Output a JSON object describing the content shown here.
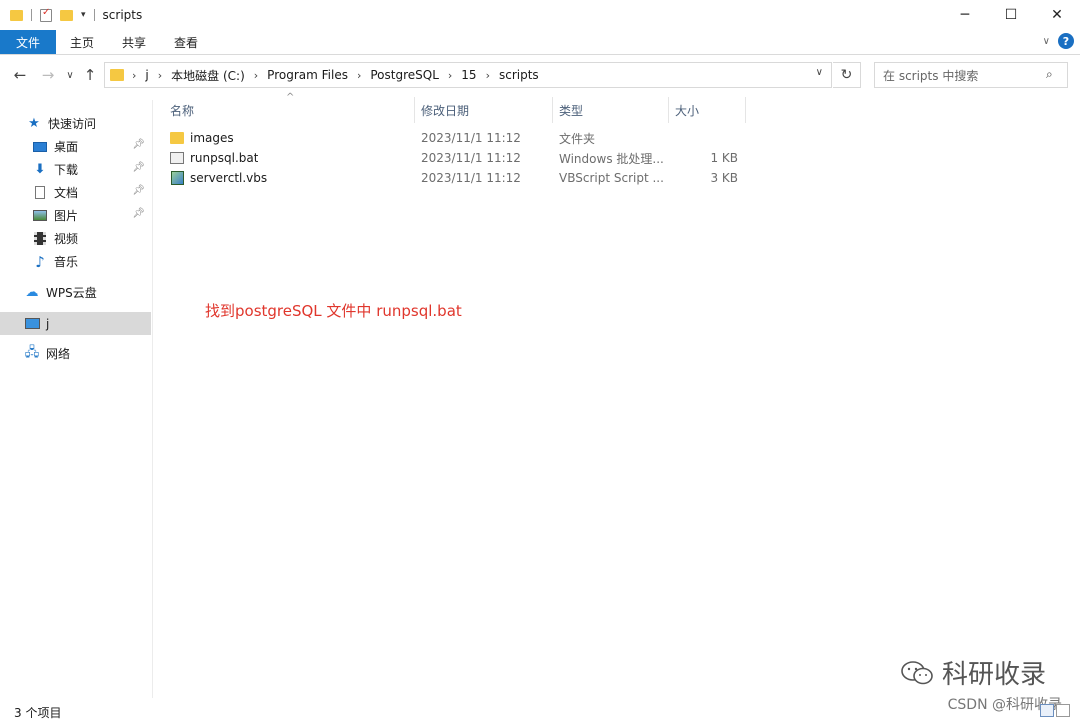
{
  "window": {
    "title": "scripts"
  },
  "ribbon": {
    "tabs": [
      "文件",
      "主页",
      "共享",
      "查看"
    ]
  },
  "address": {
    "crumbs": [
      "j",
      "本地磁盘 (C:)",
      "Program Files",
      "PostgreSQL",
      "15",
      "scripts"
    ],
    "search_placeholder": "在 scripts 中搜索"
  },
  "navpane": {
    "quick_access": "快速访问",
    "items": [
      {
        "label": "桌面",
        "icon": "desktop-icon",
        "pinned": true
      },
      {
        "label": "下载",
        "icon": "download-icon",
        "pinned": true
      },
      {
        "label": "文档",
        "icon": "document-icon",
        "pinned": true
      },
      {
        "label": "图片",
        "icon": "picture-icon",
        "pinned": true
      },
      {
        "label": "视频",
        "icon": "video-icon",
        "pinned": false
      },
      {
        "label": "音乐",
        "icon": "music-icon",
        "pinned": false
      }
    ],
    "wps": "WPS云盘",
    "computer": "j",
    "network": "网络"
  },
  "columns": {
    "name": "名称",
    "date": "修改日期",
    "type": "类型",
    "size": "大小"
  },
  "files": [
    {
      "name": "images",
      "date": "2023/11/1 11:12",
      "type": "文件夹",
      "size": "",
      "icon": "folder-icon"
    },
    {
      "name": "runpsql.bat",
      "date": "2023/11/1 11:12",
      "type": "Windows 批处理...",
      "size": "1 KB",
      "icon": "batch-file-icon"
    },
    {
      "name": "serverctl.vbs",
      "date": "2023/11/1 11:12",
      "type": "VBScript Script ...",
      "size": "3 KB",
      "icon": "vbscript-file-icon"
    }
  ],
  "annotation": "找到postgreSQL 文件中 runpsql.bat",
  "status": {
    "count": "3 个项目"
  },
  "watermark": {
    "brand": "科研收录",
    "credit": "CSDN @科研收录"
  },
  "colors": {
    "file_tab": "#1979ca",
    "annotation": "#e0362c",
    "folder": "#f5c842"
  }
}
